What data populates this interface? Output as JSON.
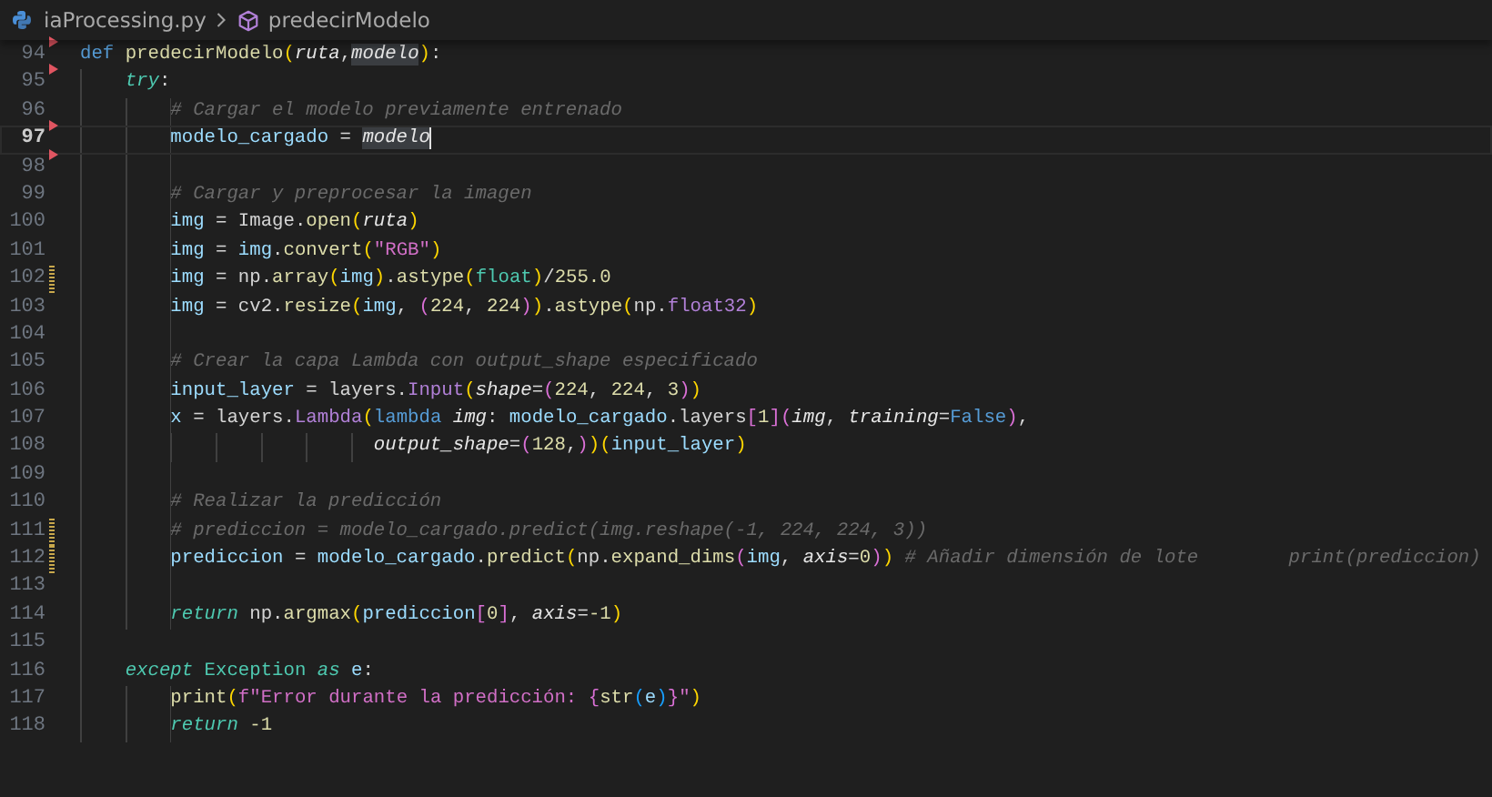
{
  "breadcrumb": {
    "file": "iaProcessing.py",
    "symbol": "predecirModelo"
  },
  "lines": [
    {
      "number": "94",
      "current": false,
      "modified": false,
      "deleted_above": true,
      "tokens": [
        {
          "kind": "kw",
          "t": "def "
        },
        {
          "kind": "fn",
          "t": "predecirModelo"
        },
        {
          "kind": "b1",
          "t": "("
        },
        {
          "kind": "param",
          "t": "ruta"
        },
        {
          "kind": "p",
          "t": ","
        },
        {
          "kind": "match",
          "t": "modelo"
        },
        {
          "kind": "b1",
          "t": ")"
        },
        {
          "kind": "p",
          "t": ":"
        }
      ],
      "children": [
        {
          "number": "95",
          "current": false,
          "modified": false,
          "deleted_above": true,
          "tokens": [
            {
              "kind": "ctl",
              "t": "try"
            },
            {
              "kind": "p",
              "t": ":"
            }
          ],
          "children": [
            {
              "number": "96",
              "current": false,
              "modified": false,
              "deleted_above": false,
              "tokens": [
                {
                  "kind": "cm",
                  "t": "# Cargar el modelo previamente entrenado"
                }
              ]
            },
            {
              "number": "97",
              "current": true,
              "modified": false,
              "deleted_above": true,
              "tokens": [
                {
                  "kind": "var",
                  "t": "modelo_cargado"
                },
                {
                  "kind": "p",
                  "t": " = "
                },
                {
                  "kind": "match",
                  "t": "modelo"
                }
              ]
            },
            {
              "number": "98",
              "current": false,
              "modified": false,
              "deleted_above": true
            },
            {
              "number": "99",
              "current": false,
              "modified": false,
              "deleted_above": false,
              "tokens": [
                {
                  "kind": "cm",
                  "t": "# Cargar y preprocesar la imagen"
                }
              ]
            },
            {
              "number": "100",
              "current": false,
              "modified": false,
              "deleted_above": false,
              "tokens": [
                {
                  "kind": "var",
                  "t": "img"
                },
                {
                  "kind": "p",
                  "t": " = Image."
                },
                {
                  "kind": "fn",
                  "t": "open"
                },
                {
                  "kind": "b1",
                  "t": "("
                },
                {
                  "kind": "param",
                  "t": "ruta"
                },
                {
                  "kind": "b1",
                  "t": ")"
                }
              ]
            },
            {
              "number": "101",
              "current": false,
              "modified": false,
              "deleted_above": false,
              "tokens": [
                {
                  "kind": "var",
                  "t": "img"
                },
                {
                  "kind": "p",
                  "t": " = "
                },
                {
                  "kind": "var",
                  "t": "img"
                },
                {
                  "kind": "p",
                  "t": "."
                },
                {
                  "kind": "fn",
                  "t": "convert"
                },
                {
                  "kind": "b1",
                  "t": "("
                },
                {
                  "kind": "str",
                  "t": "\"RGB\""
                },
                {
                  "kind": "b1",
                  "t": ")"
                }
              ]
            },
            {
              "number": "102",
              "current": false,
              "modified": true,
              "deleted_above": false,
              "tokens": [
                {
                  "kind": "var",
                  "t": "img"
                },
                {
                  "kind": "p",
                  "t": " = np."
                },
                {
                  "kind": "fn",
                  "t": "array"
                },
                {
                  "kind": "b1",
                  "t": "("
                },
                {
                  "kind": "var",
                  "t": "img"
                },
                {
                  "kind": "b1",
                  "t": ")"
                },
                {
                  "kind": "p",
                  "t": "."
                },
                {
                  "kind": "fn",
                  "t": "astype"
                },
                {
                  "kind": "b1",
                  "t": "("
                },
                {
                  "kind": "type",
                  "t": "float"
                },
                {
                  "kind": "b1",
                  "t": ")"
                },
                {
                  "kind": "p",
                  "t": "/"
                },
                {
                  "kind": "num",
                  "t": "255.0"
                }
              ]
            },
            {
              "number": "103",
              "current": false,
              "modified": false,
              "deleted_above": false,
              "tokens": [
                {
                  "kind": "var",
                  "t": "img"
                },
                {
                  "kind": "p",
                  "t": " = cv2."
                },
                {
                  "kind": "fn",
                  "t": "resize"
                },
                {
                  "kind": "b1",
                  "t": "("
                },
                {
                  "kind": "var",
                  "t": "img"
                },
                {
                  "kind": "p",
                  "t": ", "
                },
                {
                  "kind": "b2",
                  "t": "("
                },
                {
                  "kind": "num",
                  "t": "224"
                },
                {
                  "kind": "p",
                  "t": ", "
                },
                {
                  "kind": "num",
                  "t": "224"
                },
                {
                  "kind": "b2",
                  "t": ")"
                },
                {
                  "kind": "b1",
                  "t": ")"
                },
                {
                  "kind": "p",
                  "t": "."
                },
                {
                  "kind": "fn",
                  "t": "astype"
                },
                {
                  "kind": "b1",
                  "t": "("
                },
                {
                  "kind": "p",
                  "t": "np."
                },
                {
                  "kind": "cls",
                  "t": "float32"
                },
                {
                  "kind": "b1",
                  "t": ")"
                }
              ]
            },
            {
              "number": "104",
              "current": false,
              "modified": false,
              "deleted_above": false
            },
            {
              "number": "105",
              "current": false,
              "modified": false,
              "deleted_above": false,
              "tokens": [
                {
                  "kind": "cm",
                  "t": "# Crear la capa Lambda con output_shape especificado"
                }
              ]
            },
            {
              "number": "106",
              "current": false,
              "modified": false,
              "deleted_above": false,
              "tokens": [
                {
                  "kind": "var",
                  "t": "input_layer"
                },
                {
                  "kind": "p",
                  "t": " = layers."
                },
                {
                  "kind": "cls",
                  "t": "Input"
                },
                {
                  "kind": "b1",
                  "t": "("
                },
                {
                  "kind": "param",
                  "t": "shape"
                },
                {
                  "kind": "p",
                  "t": "="
                },
                {
                  "kind": "b2",
                  "t": "("
                },
                {
                  "kind": "num",
                  "t": "224"
                },
                {
                  "kind": "p",
                  "t": ", "
                },
                {
                  "kind": "num",
                  "t": "224"
                },
                {
                  "kind": "p",
                  "t": ", "
                },
                {
                  "kind": "num",
                  "t": "3"
                },
                {
                  "kind": "b2",
                  "t": ")"
                },
                {
                  "kind": "b1",
                  "t": ")"
                }
              ]
            },
            {
              "number": "107",
              "current": false,
              "modified": false,
              "deleted_above": false,
              "tokens": [
                {
                  "kind": "var",
                  "t": "x"
                },
                {
                  "kind": "p",
                  "t": " = layers."
                },
                {
                  "kind": "cls",
                  "t": "Lambda"
                },
                {
                  "kind": "b1",
                  "t": "("
                },
                {
                  "kind": "kw",
                  "t": "lambda "
                },
                {
                  "kind": "param",
                  "t": "img"
                },
                {
                  "kind": "p",
                  "t": ": "
                },
                {
                  "kind": "var",
                  "t": "modelo_cargado"
                },
                {
                  "kind": "p",
                  "t": ".layers"
                },
                {
                  "kind": "b2",
                  "t": "["
                },
                {
                  "kind": "num",
                  "t": "1"
                },
                {
                  "kind": "b2",
                  "t": "]"
                },
                {
                  "kind": "b2",
                  "t": "("
                },
                {
                  "kind": "param",
                  "t": "img"
                },
                {
                  "kind": "p",
                  "t": ", "
                },
                {
                  "kind": "param",
                  "t": "training"
                },
                {
                  "kind": "p",
                  "t": "="
                },
                {
                  "kind": "kw",
                  "t": "False"
                },
                {
                  "kind": "b2",
                  "t": ")"
                },
                {
                  "kind": "p",
                  "t": ","
                }
              ]
            },
            {
              "number": "108",
              "current": false,
              "modified": false,
              "deleted_above": false,
              "continuation": true,
              "tokens": [
                {
                  "kind": "param",
                  "t": "output_shape"
                },
                {
                  "kind": "p",
                  "t": "="
                },
                {
                  "kind": "b2",
                  "t": "("
                },
                {
                  "kind": "num",
                  "t": "128"
                },
                {
                  "kind": "p",
                  "t": ","
                },
                {
                  "kind": "b2",
                  "t": ")"
                },
                {
                  "kind": "b1",
                  "t": ")"
                },
                {
                  "kind": "b1",
                  "t": "("
                },
                {
                  "kind": "var",
                  "t": "input_layer"
                },
                {
                  "kind": "b1",
                  "t": ")"
                }
              ]
            },
            {
              "number": "109",
              "current": false,
              "modified": false,
              "deleted_above": false
            },
            {
              "number": "110",
              "current": false,
              "modified": false,
              "deleted_above": false,
              "tokens": [
                {
                  "kind": "cm",
                  "t": "# Realizar la predicción"
                }
              ]
            },
            {
              "number": "111",
              "current": false,
              "modified": true,
              "deleted_above": false,
              "tokens": [
                {
                  "kind": "cm",
                  "t": "# prediccion = modelo_cargado.predict(img.reshape(-1, 224, 224, 3))"
                }
              ]
            },
            {
              "number": "112",
              "current": false,
              "modified": true,
              "deleted_above": false,
              "tokens": [
                {
                  "kind": "var",
                  "t": "prediccion"
                },
                {
                  "kind": "p",
                  "t": " = "
                },
                {
                  "kind": "var",
                  "t": "modelo_cargado"
                },
                {
                  "kind": "p",
                  "t": "."
                },
                {
                  "kind": "fn",
                  "t": "predict"
                },
                {
                  "kind": "b1",
                  "t": "("
                },
                {
                  "kind": "p",
                  "t": "np."
                },
                {
                  "kind": "fn",
                  "t": "expand_dims"
                },
                {
                  "kind": "b2",
                  "t": "("
                },
                {
                  "kind": "var",
                  "t": "img"
                },
                {
                  "kind": "p",
                  "t": ", "
                },
                {
                  "kind": "param",
                  "t": "axis"
                },
                {
                  "kind": "p",
                  "t": "="
                },
                {
                  "kind": "num",
                  "t": "0"
                },
                {
                  "kind": "b2",
                  "t": ")"
                },
                {
                  "kind": "b1",
                  "t": ")"
                },
                {
                  "kind": "cm",
                  "t": " # Añadir dimensión de lote        print(prediccion)"
                }
              ]
            },
            {
              "number": "113",
              "current": false,
              "modified": false,
              "deleted_above": false
            },
            {
              "number": "114",
              "current": false,
              "modified": false,
              "deleted_above": false,
              "tokens": [
                {
                  "kind": "ctl",
                  "t": "return"
                },
                {
                  "kind": "p",
                  "t": " np."
                },
                {
                  "kind": "fn",
                  "t": "argmax"
                },
                {
                  "kind": "b1",
                  "t": "("
                },
                {
                  "kind": "var",
                  "t": "prediccion"
                },
                {
                  "kind": "b2",
                  "t": "["
                },
                {
                  "kind": "num",
                  "t": "0"
                },
                {
                  "kind": "b2",
                  "t": "]"
                },
                {
                  "kind": "p",
                  "t": ", "
                },
                {
                  "kind": "param",
                  "t": "axis"
                },
                {
                  "kind": "p",
                  "t": "="
                },
                {
                  "kind": "num",
                  "t": "-1"
                },
                {
                  "kind": "b1",
                  "t": ")"
                }
              ]
            }
          ]
        },
        {
          "number": "115",
          "current": false,
          "modified": false,
          "deleted_above": false
        },
        {
          "number": "116",
          "current": false,
          "modified": false,
          "deleted_above": false,
          "tokens": [
            {
              "kind": "ctl",
              "t": "except"
            },
            {
              "kind": "type",
              "t": " Exception "
            },
            {
              "kind": "ctl",
              "t": "as"
            },
            {
              "kind": "var",
              "t": " e"
            },
            {
              "kind": "p",
              "t": ":"
            }
          ],
          "children": [
            {
              "number": "117",
              "current": false,
              "modified": false,
              "deleted_above": false,
              "tokens": [
                {
                  "kind": "fn",
                  "t": "print"
                },
                {
                  "kind": "b1",
                  "t": "("
                },
                {
                  "kind": "str",
                  "t": "f\"Error durante la predicción: "
                },
                {
                  "kind": "b2",
                  "t": "{"
                },
                {
                  "kind": "fn",
                  "t": "str"
                },
                {
                  "kind": "b3",
                  "t": "("
                },
                {
                  "kind": "var",
                  "t": "e"
                },
                {
                  "kind": "b3",
                  "t": ")"
                },
                {
                  "kind": "b2",
                  "t": "}"
                },
                {
                  "kind": "str",
                  "t": "\""
                },
                {
                  "kind": "b1",
                  "t": ")"
                }
              ]
            },
            {
              "number": "118",
              "current": false,
              "modified": false,
              "deleted_above": false,
              "tokens": [
                {
                  "kind": "ctl",
                  "t": "return"
                },
                {
                  "kind": "num",
                  "t": " -1"
                }
              ]
            }
          ]
        }
      ]
    }
  ]
}
